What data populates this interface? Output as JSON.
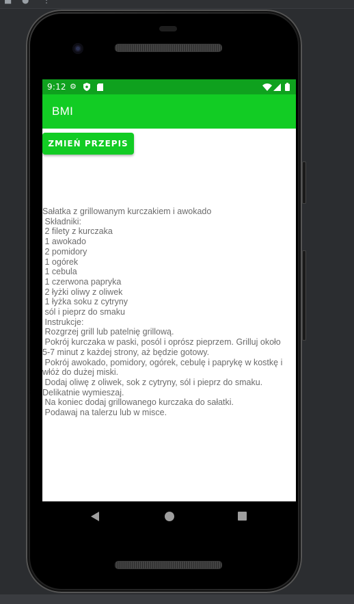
{
  "status_bar": {
    "time": "9:12",
    "icons": [
      "settings-gear-icon",
      "shield-icon",
      "sd-card-icon",
      "wifi-icon",
      "signal-icon",
      "battery-icon"
    ]
  },
  "app_bar": {
    "title": "BMI"
  },
  "change_button": {
    "label": "ZMIEŃ PRZEPIS"
  },
  "recipe": {
    "text": "Sałatka z grillowanym kurczakiem i awokado\n Składniki:\n 2 filety z kurczaka\n 1 awokado\n 2 pomidory\n 1 ogórek\n 1 cebula\n 1 czerwona papryka\n 2 łyżki oliwy z oliwek\n 1 łyżka soku z cytryny\n sól i pieprz do smaku\n Instrukcje:\n Rozgrzej grill lub patelnię grillową.\n Pokrój kurczaka w paski, posól i oprósz pieprzem. Grilluj około 5-7 minut z każdej strony, aż będzie gotowy.\n Pokrój awokado, pomidory, ogórek, cebulę i paprykę w kostkę i włóż do dużej miski.\n Dodaj oliwę z oliwek, sok z cytryny, sól i pieprz do smaku. Delikatnie wymieszaj.\n Na koniec dodaj grillowanego kurczaka do sałatki.\n Podawaj na talerzu lub w misce."
  },
  "nav_bar": {
    "icons": [
      "back-icon",
      "home-icon",
      "recents-icon"
    ]
  },
  "colors": {
    "status_bar": "#0fa11e",
    "app_bar": "#12cc24",
    "button": "#12cc24",
    "recipe_text": "#6b6b6b"
  }
}
